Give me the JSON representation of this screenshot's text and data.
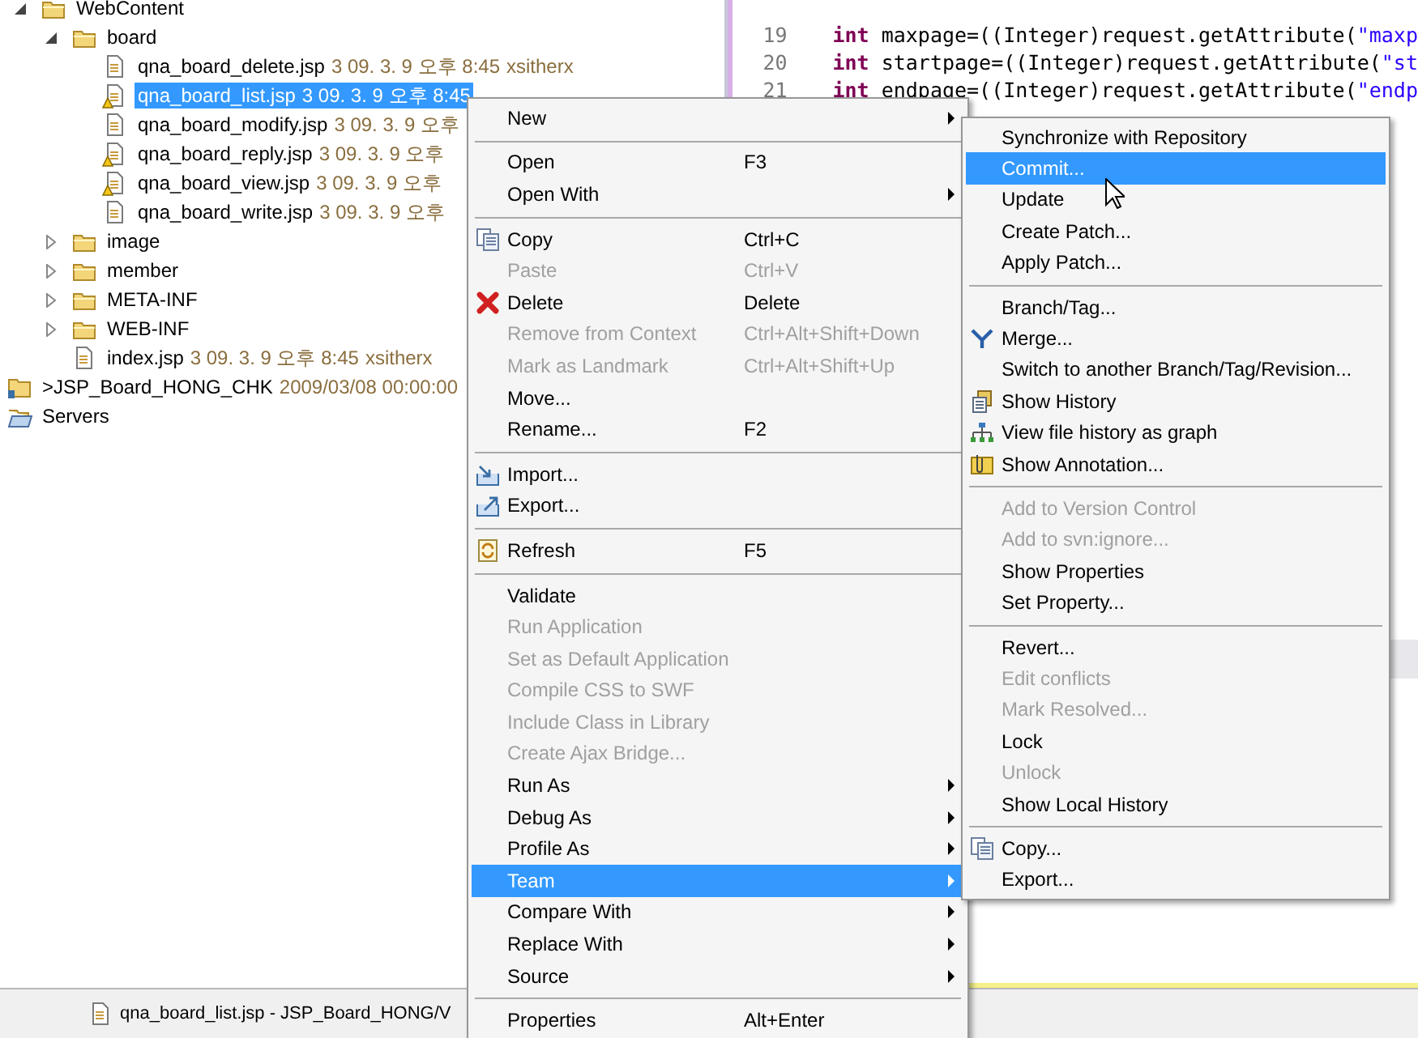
{
  "explorer": {
    "open_project_contents": [
      {
        "kind": "folder",
        "name": "WebContent",
        "expanded": true,
        "children": [
          {
            "kind": "folder",
            "name": "board",
            "expanded": true,
            "children": [
              {
                "kind": "file",
                "name": "qna_board_delete.jsp",
                "meta": "3  09. 3. 9 오후 8:45",
                "author": "xsitherx",
                "warning": false,
                "selected": false
              },
              {
                "kind": "file",
                "name": "qna_board_list.jsp",
                "meta": "3  09. 3. 9 오후 8:45",
                "warning": true,
                "selected": true
              },
              {
                "kind": "file",
                "name": "qna_board_modify.jsp",
                "meta": "3  09. 3. 9 오후",
                "warning": false,
                "selected": false
              },
              {
                "kind": "file",
                "name": "qna_board_reply.jsp",
                "meta": "3  09. 3. 9 오후",
                "warning": true,
                "selected": false
              },
              {
                "kind": "file",
                "name": "qna_board_view.jsp",
                "meta": "3  09. 3. 9 오후",
                "warning": true,
                "selected": false
              },
              {
                "kind": "file",
                "name": "qna_board_write.jsp",
                "meta": "3  09. 3. 9 오후",
                "warning": false,
                "selected": false
              }
            ]
          },
          {
            "kind": "folder",
            "name": "image",
            "expanded": false
          },
          {
            "kind": "folder",
            "name": "member",
            "expanded": false
          },
          {
            "kind": "folder",
            "name": "META-INF",
            "expanded": false
          },
          {
            "kind": "folder",
            "name": "WEB-INF",
            "expanded": false
          },
          {
            "kind": "file",
            "name": "index.jsp",
            "meta": "3  09. 3. 9 오후 8:45",
            "author": "xsitherx",
            "warning": false,
            "selected": false
          }
        ]
      }
    ],
    "other_items": [
      {
        "kind": "project",
        "name": ">JSP_Board_HONG_CHK",
        "meta": "2009/03/08 00:00:00"
      },
      {
        "kind": "servers",
        "name": "Servers"
      }
    ]
  },
  "editor": {
    "lines": [
      {
        "number": "19",
        "keyword": "int",
        "code": " maxpage=((Integer)request.getAttribute(",
        "string": "\"maxp"
      },
      {
        "number": "20",
        "keyword": "int",
        "code": " startpage=((Integer)request.getAttribute(",
        "string": "\"st"
      },
      {
        "number": "21",
        "keyword": "int",
        "code": " endpage=((Integer)request.getAttribute(",
        "string": "\"endp"
      }
    ]
  },
  "context_menu": {
    "items": [
      {
        "kind": "item",
        "label": "New",
        "submenu": true,
        "disabled": false,
        "selected": false
      },
      {
        "kind": "separator"
      },
      {
        "kind": "item",
        "label": "Open",
        "shortcut": "F3",
        "submenu": false,
        "disabled": false,
        "selected": false
      },
      {
        "kind": "item",
        "label": "Open With",
        "submenu": true,
        "disabled": false,
        "selected": false
      },
      {
        "kind": "separator"
      },
      {
        "kind": "item",
        "label": "Copy",
        "shortcut": "Ctrl+C",
        "submenu": false,
        "disabled": false,
        "selected": false
      },
      {
        "kind": "item",
        "label": "Paste",
        "shortcut": "Ctrl+V",
        "submenu": false,
        "disabled": true,
        "selected": false
      },
      {
        "kind": "item",
        "label": "Delete",
        "shortcut": "Delete",
        "submenu": false,
        "disabled": false,
        "selected": false
      },
      {
        "kind": "item",
        "label": "Remove from Context",
        "shortcut": "Ctrl+Alt+Shift+Down",
        "submenu": false,
        "disabled": true,
        "selected": false
      },
      {
        "kind": "item",
        "label": "Mark as Landmark",
        "shortcut": "Ctrl+Alt+Shift+Up",
        "submenu": false,
        "disabled": true,
        "selected": false
      },
      {
        "kind": "item",
        "label": "Move...",
        "submenu": false,
        "disabled": false,
        "selected": false
      },
      {
        "kind": "item",
        "label": "Rename...",
        "shortcut": "F2",
        "submenu": false,
        "disabled": false,
        "selected": false
      },
      {
        "kind": "separator"
      },
      {
        "kind": "item",
        "label": "Import...",
        "submenu": false,
        "disabled": false,
        "selected": false
      },
      {
        "kind": "item",
        "label": "Export...",
        "submenu": false,
        "disabled": false,
        "selected": false
      },
      {
        "kind": "separator"
      },
      {
        "kind": "item",
        "label": "Refresh",
        "shortcut": "F5",
        "submenu": false,
        "disabled": false,
        "selected": false
      },
      {
        "kind": "separator"
      },
      {
        "kind": "item",
        "label": "Validate",
        "submenu": false,
        "disabled": false,
        "selected": false
      },
      {
        "kind": "item",
        "label": "Run Application",
        "submenu": false,
        "disabled": true,
        "selected": false
      },
      {
        "kind": "item",
        "label": "Set as Default Application",
        "submenu": false,
        "disabled": true,
        "selected": false
      },
      {
        "kind": "item",
        "label": "Compile CSS to SWF",
        "submenu": false,
        "disabled": true,
        "selected": false
      },
      {
        "kind": "item",
        "label": "Include Class in Library",
        "submenu": false,
        "disabled": true,
        "selected": false
      },
      {
        "kind": "item",
        "label": "Create Ajax Bridge...",
        "submenu": false,
        "disabled": true,
        "selected": false
      },
      {
        "kind": "item",
        "label": "Run As",
        "submenu": true,
        "disabled": false,
        "selected": false
      },
      {
        "kind": "item",
        "label": "Debug As",
        "submenu": true,
        "disabled": false,
        "selected": false
      },
      {
        "kind": "item",
        "label": "Profile As",
        "submenu": true,
        "disabled": false,
        "selected": false
      },
      {
        "kind": "item",
        "label": "Team",
        "submenu": true,
        "disabled": false,
        "selected": true
      },
      {
        "kind": "item",
        "label": "Compare With",
        "submenu": true,
        "disabled": false,
        "selected": false
      },
      {
        "kind": "item",
        "label": "Replace With",
        "submenu": true,
        "disabled": false,
        "selected": false
      },
      {
        "kind": "item",
        "label": "Source",
        "submenu": true,
        "disabled": false,
        "selected": false
      },
      {
        "kind": "separator"
      },
      {
        "kind": "item",
        "label": "Properties",
        "shortcut": "Alt+Enter",
        "submenu": false,
        "disabled": false,
        "selected": false
      }
    ]
  },
  "team_submenu": {
    "items": [
      {
        "kind": "item",
        "label": "Synchronize with Repository",
        "disabled": false,
        "selected": false
      },
      {
        "kind": "item",
        "label": "Commit...",
        "disabled": false,
        "selected": true
      },
      {
        "kind": "item",
        "label": "Update",
        "disabled": false,
        "selected": false
      },
      {
        "kind": "item",
        "label": "Create Patch...",
        "disabled": false,
        "selected": false
      },
      {
        "kind": "item",
        "label": "Apply Patch...",
        "disabled": false,
        "selected": false
      },
      {
        "kind": "separator"
      },
      {
        "kind": "item",
        "label": "Branch/Tag...",
        "disabled": false,
        "selected": false
      },
      {
        "kind": "item",
        "label": "Merge...",
        "disabled": false,
        "selected": false
      },
      {
        "kind": "item",
        "label": "Switch to another Branch/Tag/Revision...",
        "disabled": false,
        "selected": false
      },
      {
        "kind": "item",
        "label": "Show History",
        "disabled": false,
        "selected": false
      },
      {
        "kind": "item",
        "label": "View file history as graph",
        "disabled": false,
        "selected": false
      },
      {
        "kind": "item",
        "label": "Show Annotation...",
        "disabled": false,
        "selected": false
      },
      {
        "kind": "separator"
      },
      {
        "kind": "item",
        "label": "Add to Version Control",
        "disabled": true,
        "selected": false
      },
      {
        "kind": "item",
        "label": "Add to svn:ignore...",
        "disabled": true,
        "selected": false
      },
      {
        "kind": "item",
        "label": "Show Properties",
        "disabled": false,
        "selected": false
      },
      {
        "kind": "item",
        "label": "Set Property...",
        "disabled": false,
        "selected": false
      },
      {
        "kind": "separator"
      },
      {
        "kind": "item",
        "label": "Revert...",
        "disabled": false,
        "selected": false
      },
      {
        "kind": "item",
        "label": "Edit conflicts",
        "disabled": true,
        "selected": false
      },
      {
        "kind": "item",
        "label": "Mark Resolved...",
        "disabled": true,
        "selected": false
      },
      {
        "kind": "item",
        "label": "Lock",
        "disabled": false,
        "selected": false
      },
      {
        "kind": "item",
        "label": "Unlock",
        "disabled": true,
        "selected": false
      },
      {
        "kind": "item",
        "label": "Show Local History",
        "disabled": false,
        "selected": false
      },
      {
        "kind": "separator"
      },
      {
        "kind": "item",
        "label": "Copy...",
        "disabled": false,
        "selected": false
      },
      {
        "kind": "item",
        "label": "Export...",
        "disabled": false,
        "selected": false
      }
    ]
  },
  "status_bar": {
    "editor_tab": "qna_board_list.jsp - JSP_Board_HONG/V"
  }
}
